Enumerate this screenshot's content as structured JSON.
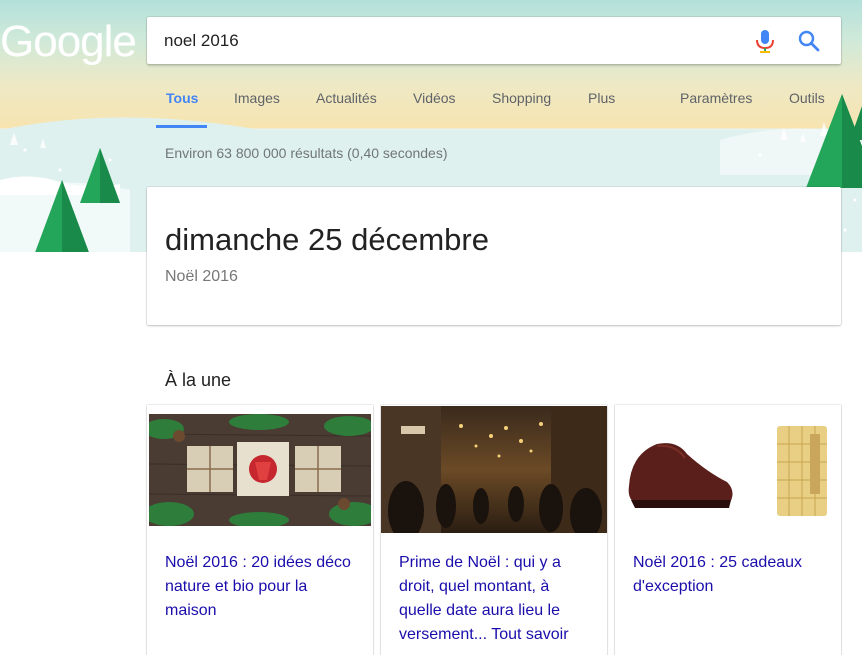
{
  "logo": {
    "text": "Google"
  },
  "search": {
    "query": "noel 2016"
  },
  "icons": {
    "mic": "mic-icon",
    "search": "search-icon"
  },
  "tabs": [
    {
      "label": "Tous",
      "active": true
    },
    {
      "label": "Images"
    },
    {
      "label": "Actualités"
    },
    {
      "label": "Vidéos"
    },
    {
      "label": "Shopping"
    },
    {
      "label": "Plus"
    },
    {
      "label": "Paramètres"
    },
    {
      "label": "Outils"
    }
  ],
  "result_stats": "Environ 63 800 000 résultats (0,40 secondes)",
  "answer": {
    "date": "dimanche 25 décembre",
    "subtitle": "Noël 2016"
  },
  "top_stories": {
    "title": "À la une",
    "cards": [
      {
        "title": "Noël 2016 : 20 idées déco nature et bio pour la maison"
      },
      {
        "title": "Prime de Noël : qui y a droit, quel montant, à quelle date aura lieu le versement... Tout savoir"
      },
      {
        "title": "Noël 2016 : 25 cadeaux d'exception"
      }
    ]
  },
  "colors": {
    "accent": "#4285f4",
    "link": "#1a0dab",
    "tree": "#1e9e58",
    "mic_blue": "#4285f4",
    "mic_red": "#ea4335"
  }
}
